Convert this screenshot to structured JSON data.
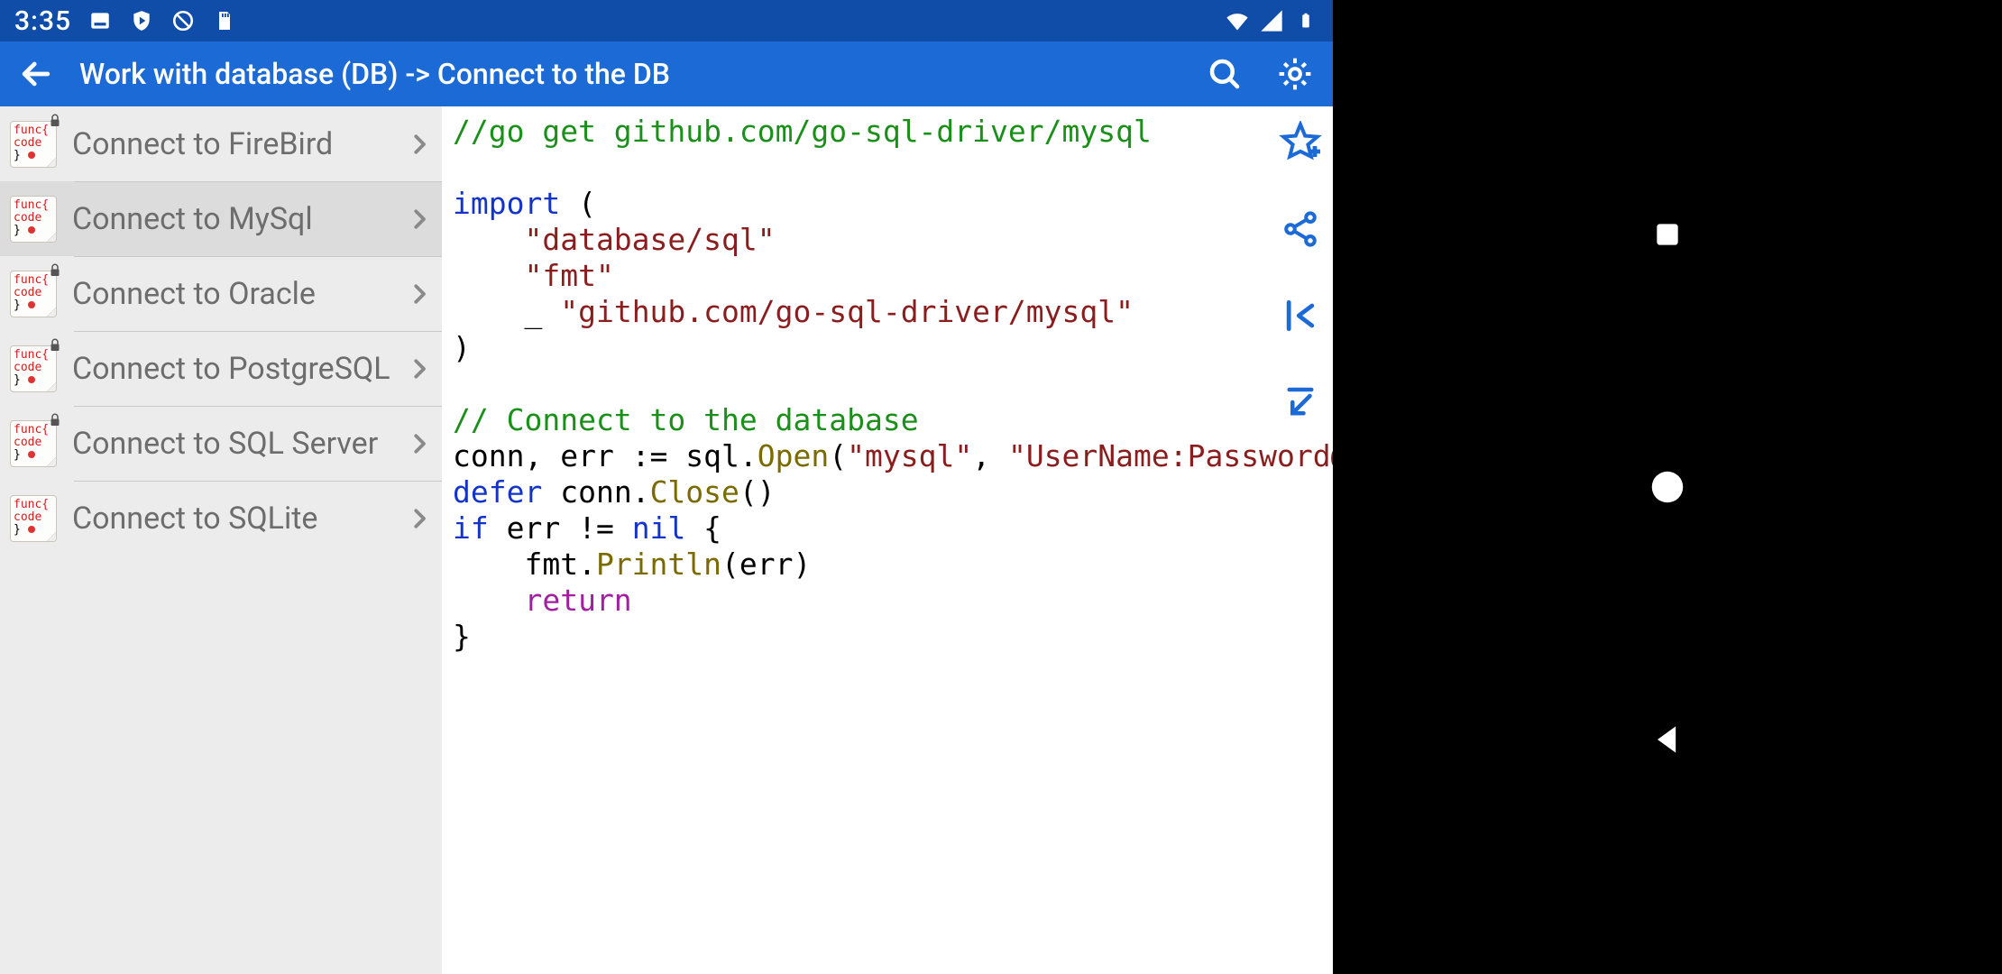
{
  "status": {
    "clock": "3:35"
  },
  "appbar": {
    "title": "Work with database (DB) -> Connect to the DB"
  },
  "sidelist": {
    "items": [
      {
        "label": "Connect to FireBird",
        "locked": true,
        "selected": false
      },
      {
        "label": "Connect to MySql",
        "locked": false,
        "selected": true
      },
      {
        "label": "Connect to Oracle",
        "locked": true,
        "selected": false
      },
      {
        "label": "Connect to PostgreSQL",
        "locked": true,
        "selected": false
      },
      {
        "label": "Connect to SQL Server",
        "locked": true,
        "selected": false
      },
      {
        "label": "Connect to SQLite",
        "locked": false,
        "selected": false
      }
    ]
  },
  "code": {
    "l0": "//go get github.com/go-sql-driver/mysql",
    "l1": "",
    "l2_kw": "import",
    "l2_rest": " (",
    "l3": "    \"database/sql\"",
    "l4": "    \"fmt\"",
    "l5_pre": "    _ ",
    "l5_str": "\"github.com/go-sql-driver/mysql\"",
    "l6": ")",
    "l7": "",
    "l8": "// Connect to the database",
    "l9_a": "conn, err := sql.",
    "l9_fn": "Open",
    "l9_b": "(",
    "l9_s1": "\"mysql\"",
    "l9_c": ", ",
    "l9_s2": "\"UserName:Password@tc",
    "l10_kw": "defer",
    "l10_a": " conn.",
    "l10_fn": "Close",
    "l10_b": "()",
    "l11_kw": "if",
    "l11_a": " err != ",
    "l11_nil": "nil",
    "l11_b": " {",
    "l12_a": "    fmt.",
    "l12_fn": "Println",
    "l12_b": "(err)",
    "l13": "    return",
    "l14": "}"
  }
}
